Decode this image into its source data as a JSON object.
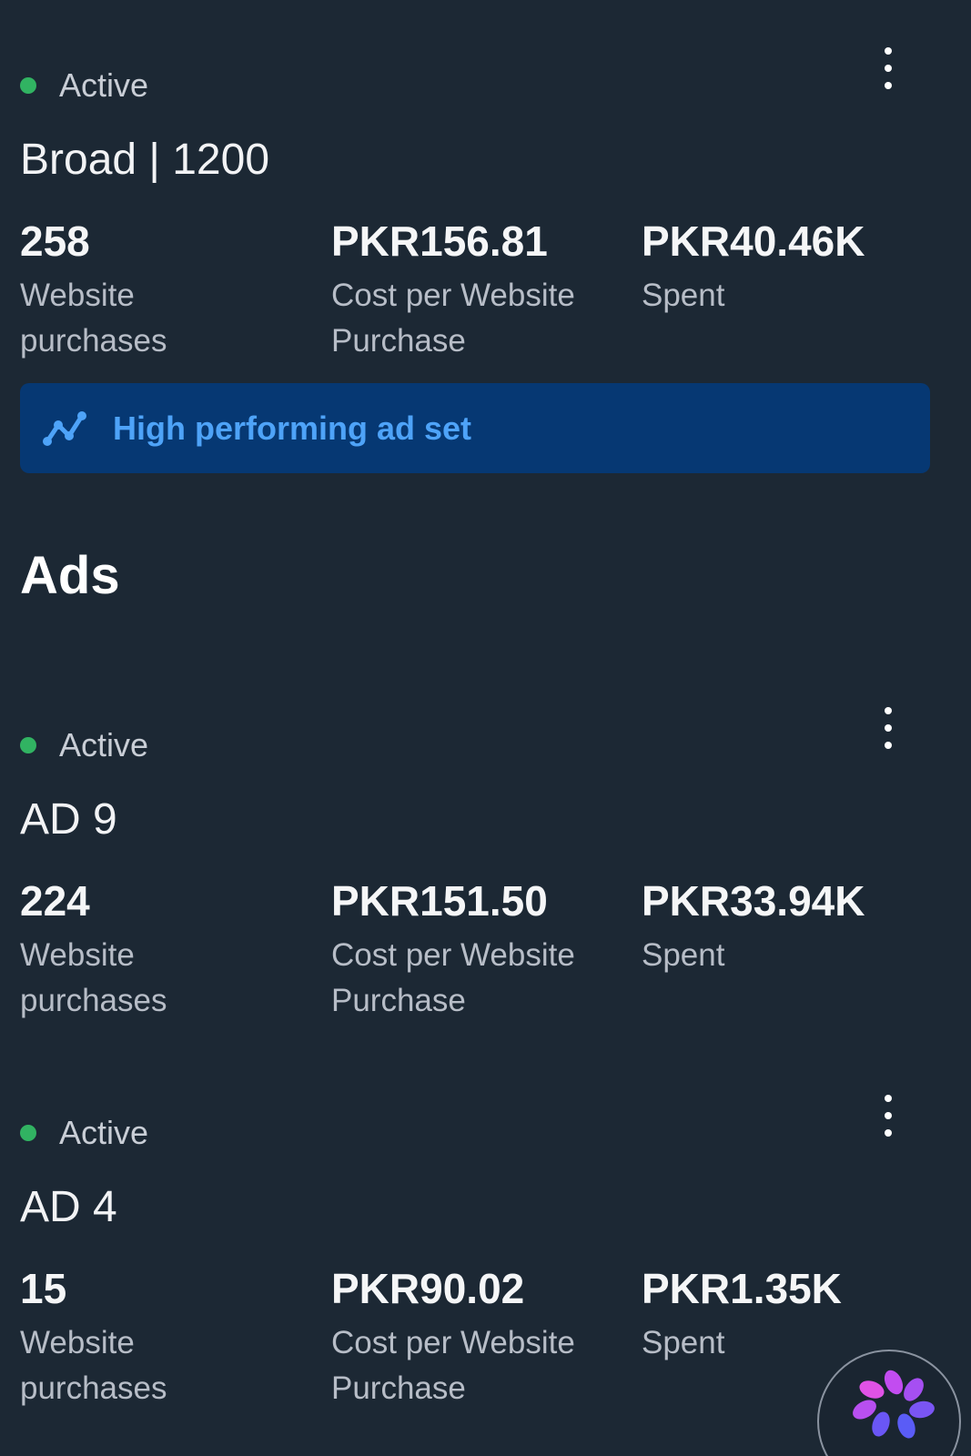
{
  "adset": {
    "status": "Active",
    "name": "Broad | 1200",
    "metrics": [
      {
        "value": "258",
        "label": "Website purchases"
      },
      {
        "value": "PKR156.81",
        "label": "Cost per Website Purchase"
      },
      {
        "value": "PKR40.46K",
        "label": "Spent"
      }
    ],
    "banner_text": "High performing ad set",
    "banner_icon": "trend-line-icon"
  },
  "ads_section": {
    "title": "Ads"
  },
  "ads": [
    {
      "status": "Active",
      "name": "AD 9",
      "metrics": [
        {
          "value": "224",
          "label": "Website purchases"
        },
        {
          "value": "PKR151.50",
          "label": "Cost per Website Purchase"
        },
        {
          "value": "PKR33.94K",
          "label": "Spent"
        }
      ]
    },
    {
      "status": "Active",
      "name": "AD 4",
      "metrics": [
        {
          "value": "15",
          "label": "Website purchases"
        },
        {
          "value": "PKR90.02",
          "label": "Cost per Website Purchase"
        },
        {
          "value": "PKR1.35K",
          "label": "Spent"
        }
      ]
    }
  ],
  "colors": {
    "background": "#1c2834",
    "active_dot": "#31b362",
    "banner_bg": "#063873",
    "banner_text": "#4ea3f8"
  },
  "icons": {
    "more": "more-vertical-icon",
    "assistant": "assistant-sparkle-icon"
  }
}
